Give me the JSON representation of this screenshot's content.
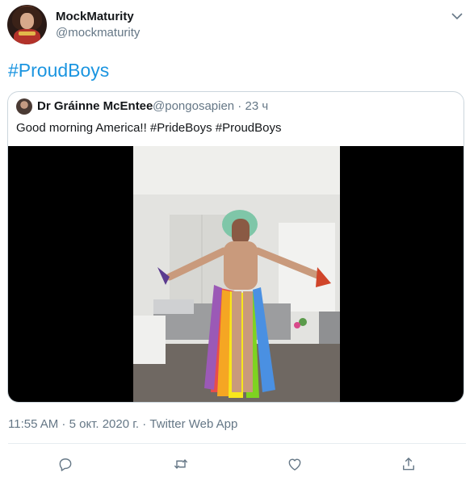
{
  "author": {
    "display_name": "MockMaturity",
    "handle": "@mockmaturity",
    "avatar_icon": "avatar-wonder-woman"
  },
  "tweet": {
    "text": "#ProudBoys",
    "link_color": "#1b95e0"
  },
  "quoted": {
    "display_name": "Dr Gráinne McEntee",
    "meta": "@pongosapien · 23 ч",
    "text": "Good morning America!! #PrideBoys #ProudBoys",
    "media_type": "video"
  },
  "footer": {
    "timestamp": "11:55 AM · 5 окт. 2020 г. · ",
    "source": "Twitter Web App"
  },
  "actions": [
    {
      "icon": "reply-icon"
    },
    {
      "icon": "retweet-icon"
    },
    {
      "icon": "like-icon"
    },
    {
      "icon": "share-icon"
    }
  ],
  "colors": {
    "text_primary": "#14171a",
    "text_secondary": "#657786",
    "border": "#ccd6dd"
  }
}
